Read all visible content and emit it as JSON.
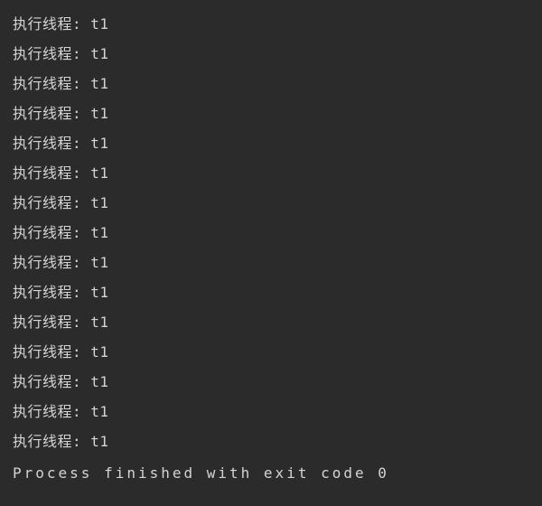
{
  "console": {
    "lines": [
      "执行线程: t1",
      "执行线程: t1",
      "执行线程: t1",
      "执行线程: t1",
      "执行线程: t1",
      "执行线程: t1",
      "执行线程: t1",
      "执行线程: t1",
      "执行线程: t1",
      "执行线程: t1",
      "执行线程: t1",
      "执行线程: t1",
      "执行线程: t1",
      "执行线程: t1",
      "执行线程: t1"
    ],
    "exit_message": "Process finished with exit code 0"
  }
}
